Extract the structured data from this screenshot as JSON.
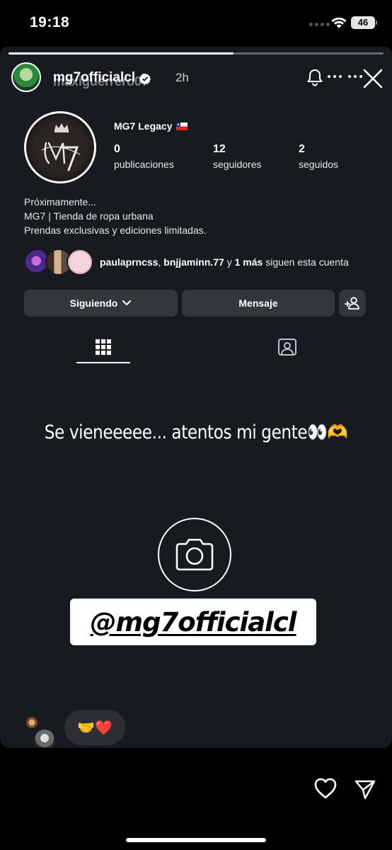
{
  "status_bar": {
    "time": "19:18",
    "battery": "46"
  },
  "story": {
    "progress_fraction": 0.6,
    "username": "mg7officialcl",
    "username_ghost": "maxiguerrero07",
    "time_ago": "2h"
  },
  "profile": {
    "name": "MG7 Legacy",
    "stats": [
      {
        "value": "0",
        "label": "publicaciones"
      },
      {
        "value": "12",
        "label": "seguidores"
      },
      {
        "value": "2",
        "label": "seguidos"
      }
    ],
    "bio": [
      "Próximamente...",
      "MG7 | Tienda de ropa urbana",
      "Prendas exclusivas y ediciones limitadas."
    ],
    "followers": {
      "user1": "paulaprncss",
      "sep1": ", ",
      "user2": "bnjjaminn.77",
      "sep2": " y ",
      "more": "1 más",
      "suffix": " siguen esta cuenta"
    },
    "buttons": {
      "following": "Siguiendo",
      "message": "Mensaje"
    }
  },
  "caption": "Se vieneeeee... atentos mi gente",
  "caption_emoji": "👀🫶",
  "mention": "@mg7officialcl",
  "reaction": "🤝❤️",
  "colors": {
    "story_bg": "#171a1e",
    "button_bg": "#33363b",
    "bubble_bg": "#2b2e33"
  }
}
